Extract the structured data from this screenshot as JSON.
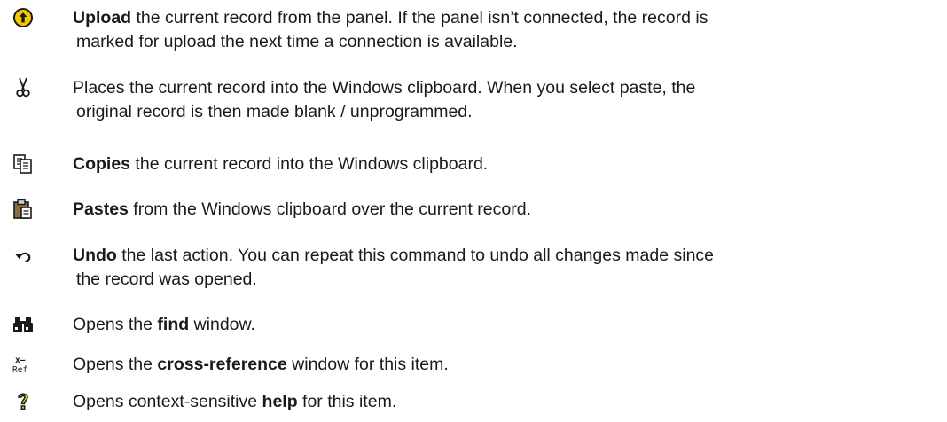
{
  "items": [
    {
      "icon": "upload-icon",
      "bold": "Upload",
      "line1": " the current record from the panel. If the panel isn’t connected, the record is",
      "line2": "marked for upload the next time a connection is available."
    },
    {
      "icon": "scissors-cut-icon",
      "line1": "Places the current record into the Windows clipboard. When you select paste, the",
      "line2": "original record is then made blank / unprogrammed."
    },
    {
      "icon": "copy-icon",
      "bold": "Copies",
      "line1": " the current record into the Windows clipboard."
    },
    {
      "icon": "paste-clipboard-icon",
      "bold": "Pastes",
      "line1": " from the Windows clipboard over the current record."
    },
    {
      "icon": "undo-arrow-icon",
      "bold": "Undo",
      "line1": " the last action. You can repeat this command to undo all changes made since",
      "line2": "the record was opened."
    },
    {
      "icon": "binoculars-icon",
      "before": "Opens the ",
      "bold": "find",
      "after": " window."
    },
    {
      "icon": "cross-reference-icon",
      "icon_text_top": "x–",
      "icon_text_bottom": "Ref",
      "before": "Opens the ",
      "bold": "cross-reference",
      "after": " window for this item."
    },
    {
      "icon": "help-question-icon",
      "before": "Opens context-sensitive ",
      "bold": "help",
      "after": " for this item."
    }
  ],
  "colors": {
    "text": "#1a1a1a",
    "upload_fill": "#f5c800",
    "icon_dark": "#1a1a1a",
    "clipboard_brown": "#8b6f3d",
    "help_yellow": "#f1d400"
  }
}
